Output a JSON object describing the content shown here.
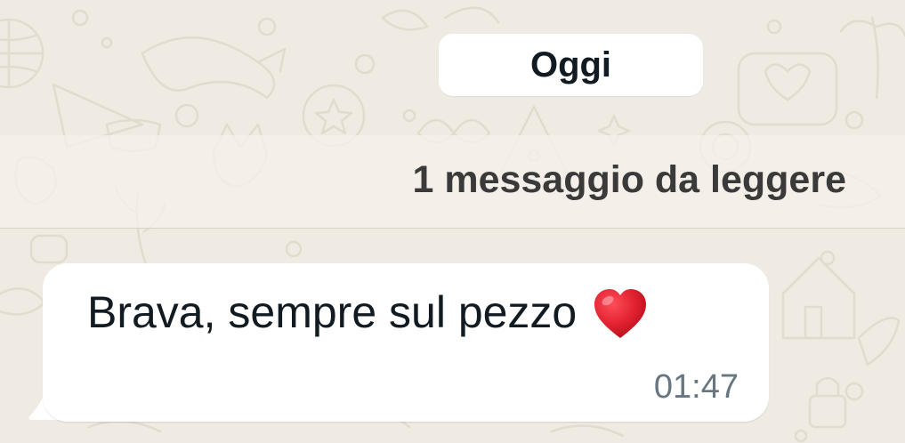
{
  "chat": {
    "date_separator": "Oggi",
    "unread_banner": "1 messaggio da leggere",
    "messages": [
      {
        "direction": "incoming",
        "text": "Brava, sempre sul pezzo",
        "emoji_icon": "red-heart-icon",
        "time": "01:47"
      }
    ]
  },
  "colors": {
    "wallpaper": "#efeae2",
    "doodle": "#e2dccf",
    "bubble": "#ffffff",
    "text": "#111b21",
    "timestamp": "#667781",
    "heart": "#e0202e"
  }
}
